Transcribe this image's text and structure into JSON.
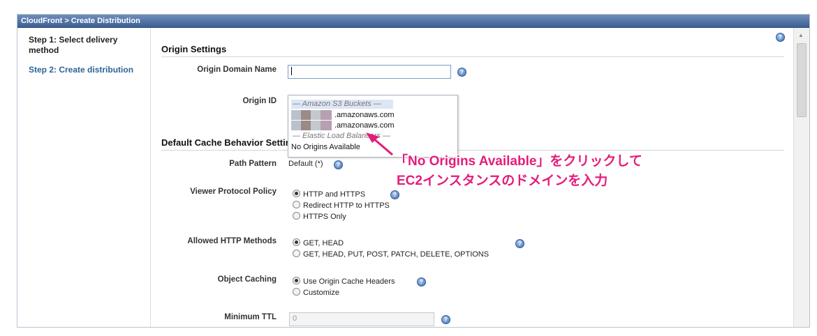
{
  "window": {
    "title": "CloudFront > Create Distribution"
  },
  "sidebar": {
    "steps": [
      {
        "label": "Step 1: Select delivery method"
      },
      {
        "label": "Step 2: Create distribution"
      }
    ]
  },
  "origin_settings": {
    "title": "Origin Settings",
    "domain_label": "Origin Domain Name",
    "domain_value": "",
    "origin_id_label": "Origin ID"
  },
  "dropdown": {
    "group_s3": "— Amazon S3 Buckets —",
    "s3_items": [
      ".amazonaws.com",
      ".amazonaws.com"
    ],
    "group_elb": "— Elastic Load Balancers —",
    "no_origins": "No Origins Available"
  },
  "cache_behavior": {
    "title": "Default Cache Behavior Settings",
    "path_pattern_label": "Path Pattern",
    "path_pattern_value": "Default (*)",
    "viewer_policy_label": "Viewer Protocol Policy",
    "viewer_policy_options": [
      "HTTP and HTTPS",
      "Redirect HTTP to HTTPS",
      "HTTPS Only"
    ],
    "viewer_policy_selected": 0,
    "methods_label": "Allowed HTTP Methods",
    "methods_options": [
      "GET, HEAD",
      "GET, HEAD, PUT, POST, PATCH, DELETE, OPTIONS"
    ],
    "methods_selected": 0,
    "caching_label": "Object Caching",
    "caching_options": [
      "Use Origin Cache Headers",
      "Customize"
    ],
    "caching_selected": 0,
    "min_ttl_label": "Minimum TTL",
    "min_ttl_value": "0"
  },
  "annotation": {
    "line1": "「No Origins Available」をクリックして",
    "line2": "EC2インスタンスのドメインを入力",
    "color": "#e41c7a"
  },
  "icons": {
    "help": "help-icon"
  }
}
